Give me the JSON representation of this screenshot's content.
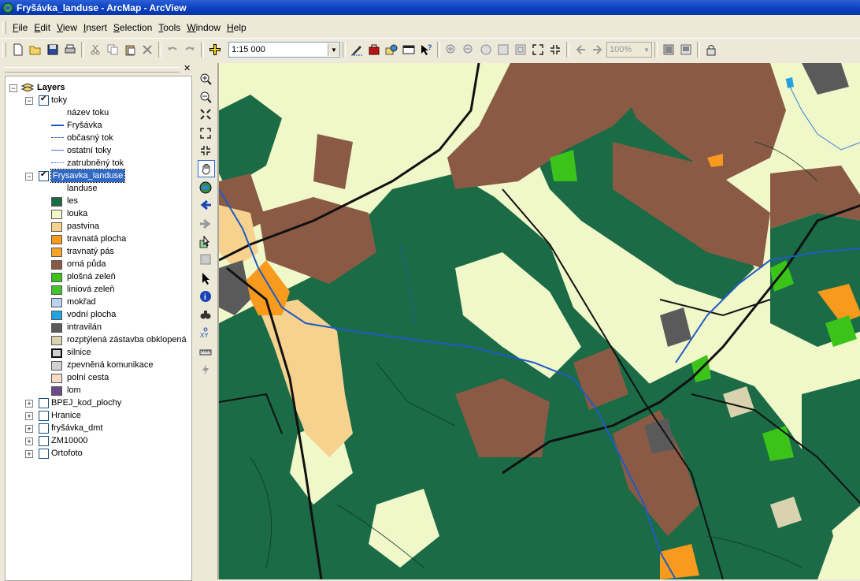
{
  "window": {
    "title": "Fryšávka_landuse - ArcMap - ArcView"
  },
  "menu": [
    "File",
    "Edit",
    "View",
    "Insert",
    "Selection",
    "Tools",
    "Window",
    "Help"
  ],
  "menu_underline": [
    "F",
    "E",
    "V",
    "I",
    "S",
    "T",
    "W",
    "H"
  ],
  "toolbar": {
    "scale": "1:15 000",
    "zoom_percent": "100%",
    "icons": [
      "new-document-icon",
      "open-folder-icon",
      "save-icon",
      "print-icon",
      "cut-icon",
      "copy-icon",
      "paste-icon",
      "delete-icon",
      "undo-icon",
      "redo-icon",
      "add-data-icon",
      "editor-icon",
      "arc-toolbox-icon",
      "arc-catalog-icon",
      "command-line-icon",
      "whats-this-icon",
      "zoom-in-fixed-icon",
      "zoom-out-fixed-icon",
      "pan-layout-icon",
      "zoom-whole-page-icon",
      "zoom-to-100-icon",
      "fixed-zoom-in-icon",
      "fixed-zoom-out-icon",
      "go-back-extent-icon",
      "go-forward-extent-icon",
      "data-view-icon",
      "layout-view-icon",
      "lock-icon"
    ]
  },
  "toc": {
    "root": "Layers",
    "layers": [
      {
        "name": "toky",
        "checked": true,
        "expanded": true,
        "field": "název toku",
        "legend": [
          {
            "label": "Fryšávka",
            "line": "solid",
            "color": "#1e5bc6"
          },
          {
            "label": "občasný tok",
            "line": "dashed",
            "color": "#1e5bc6"
          },
          {
            "label": "ostatní toky",
            "line": "solid-thin",
            "color": "#3a7fd8"
          },
          {
            "label": "zatrubněný tok",
            "line": "dotted",
            "color": "#1e5bc6"
          }
        ]
      },
      {
        "name": "Frysavka_landuse",
        "checked": true,
        "expanded": true,
        "selected": true,
        "field": "landuse",
        "legend": [
          {
            "label": "les",
            "color": "#1a6b46"
          },
          {
            "label": "louka",
            "color": "#f3f7c8"
          },
          {
            "label": "pastvina",
            "color": "#f7d28f"
          },
          {
            "label": "travnatá plocha",
            "color": "#f89a1e"
          },
          {
            "label": "travnatý pás",
            "color": "#f4a22a"
          },
          {
            "label": "orná půda",
            "color": "#8a5a44"
          },
          {
            "label": "plošná zeleň",
            "color": "#3cc31a"
          },
          {
            "label": "liniová zeleň",
            "color": "#46c22c"
          },
          {
            "label": "mokřad",
            "color": "#b8d4f0"
          },
          {
            "label": "vodní plocha",
            "color": "#22a4e2"
          },
          {
            "label": "intravilán",
            "color": "#5a5a5a"
          },
          {
            "label": "rozptýlená zástavba obklopená",
            "color": "#d8d2ae"
          },
          {
            "label": "silnice",
            "color": "#d0d0d0",
            "outline": "thick"
          },
          {
            "label": "zpevněná komunikace",
            "color": "#d2d2d2"
          },
          {
            "label": "polní cesta",
            "color": "#f6dcc4"
          },
          {
            "label": "lom",
            "color": "#6b4a86"
          }
        ]
      },
      {
        "name": "BPEJ_kod_plochy",
        "checked": false,
        "expanded": false
      },
      {
        "name": "Hranice",
        "checked": false,
        "expanded": false
      },
      {
        "name": "fryšávka_dmt",
        "checked": false,
        "expanded": false
      },
      {
        "name": "ZM10000",
        "checked": false,
        "expanded": false
      },
      {
        "name": "Ortofoto",
        "checked": false,
        "expanded": false
      }
    ]
  },
  "tools": [
    "zoom-in-icon",
    "zoom-out-icon",
    "zoom-full-out-icon",
    "fixed-zoom-in-icon",
    "fixed-zoom-out-icon",
    "pan-icon",
    "full-extent-icon",
    "back-extent-icon",
    "forward-extent-icon",
    "select-features-icon",
    "clear-selection-icon",
    "select-elements-icon",
    "identify-icon",
    "find-icon",
    "go-to-xy-icon",
    "measure-icon",
    "hyperlink-icon"
  ],
  "colors": {
    "forest": "#1a6b46",
    "meadow": "#f3f7c8",
    "pasture": "#f7d28f",
    "grass": "#f89a1e",
    "arable": "#8a5a44",
    "green": "#3cc31a",
    "urban": "#5a5a5a",
    "water": "#1e5bc6",
    "road": "#111111"
  }
}
